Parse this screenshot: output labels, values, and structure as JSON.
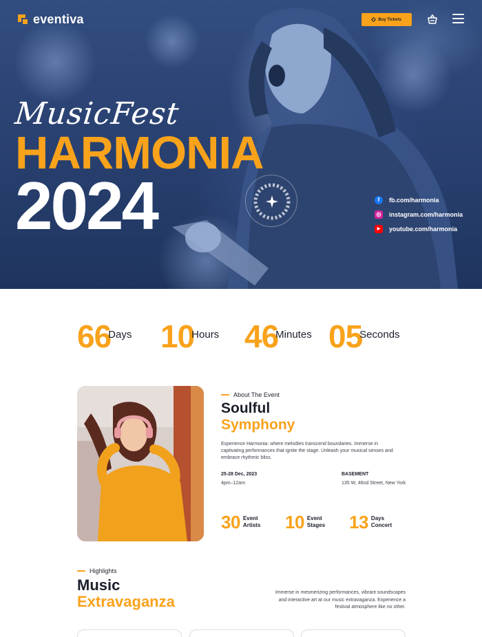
{
  "brand": {
    "name": "eventiva",
    "accent": "#f9a21b",
    "dark": "#1b1f2b"
  },
  "header": {
    "buy_label": "Buy Tickets",
    "buy_icon": "diamond-icon",
    "cart_icon": "cart-icon",
    "menu_icon": "hamburger-menu-icon"
  },
  "hero": {
    "script_title": "MusicFest",
    "title": "HARMONIA",
    "year": "2024",
    "badge_icon": "sparkle-icon",
    "socials": [
      {
        "label": "fb.com/harmonia",
        "icon": "facebook-icon",
        "color": "#1877f2"
      },
      {
        "label": "instagram.com/harmonia",
        "icon": "instagram-icon",
        "color": "#d6249f"
      },
      {
        "label": "youtube.com/harmonia",
        "icon": "youtube-icon",
        "color": "#ff0000"
      }
    ]
  },
  "countdown": [
    {
      "value": "66",
      "label": "Days"
    },
    {
      "value": "10",
      "label": "Hours"
    },
    {
      "value": "46",
      "label": "Minutes"
    },
    {
      "value": "05",
      "label": "Seconds"
    }
  ],
  "about": {
    "eyebrow": "About The Event",
    "title_line1": "Soulful",
    "title_line2": "Symphony",
    "description": "Experience Harmonia: where melodies transcend boundaries. Immerse in captivating performances that ignite the stage. Unleash your musical senses and embrace rhythmic bliss.",
    "date_label": "25-28 Dec, 2023",
    "time_value": "4pm–12am",
    "venue_label": "BASEMENT",
    "address_value": "135 W, 46nd Street, New York",
    "stats": [
      {
        "value": "30",
        "line1": "Event",
        "line2": "Artists"
      },
      {
        "value": "10",
        "line1": "Event",
        "line2": "Stages"
      },
      {
        "value": "13",
        "line1": "Days",
        "line2": "Concert"
      }
    ]
  },
  "highlights": {
    "eyebrow": "Highlights",
    "title_line1": "Music",
    "title_line2": "Extravaganza",
    "description": "Immerse in mesmerizing performances, vibrant soundscapes and interactive art at our music extravaganza. Experience a festival atmosphere like no other."
  }
}
